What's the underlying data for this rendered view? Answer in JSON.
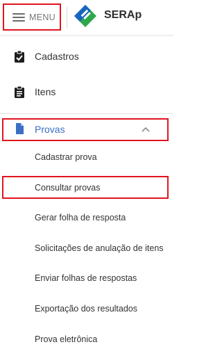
{
  "header": {
    "menu_label": "MENU",
    "brand": "SERAp"
  },
  "nav": {
    "cadastros": "Cadastros",
    "itens": "Itens",
    "provas": "Provas",
    "provas_subitems": [
      "Cadastrar prova",
      "Consultar provas",
      "Gerar folha de resposta",
      "Solicitações de anulação de itens",
      "Enviar folhas de respostas",
      "Exportação dos resultados",
      "Prova eletrônica"
    ]
  },
  "colors": {
    "highlight": "#e0141e",
    "active_text": "#3a6fc4",
    "logo_blue": "#1565c0",
    "logo_green": "#2ea84a"
  },
  "icons": {
    "menu": "hamburger-icon",
    "cadastros": "clipboard-check-icon",
    "itens": "clipboard-list-icon",
    "provas": "document-icon",
    "expand": "chevron-up-icon"
  }
}
